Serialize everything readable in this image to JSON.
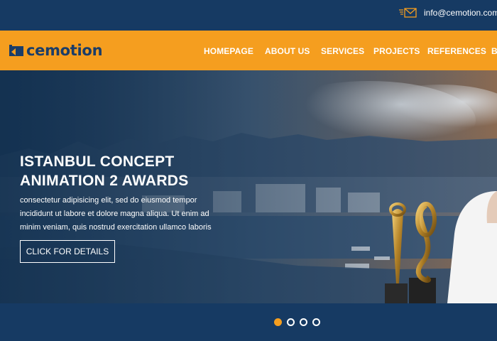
{
  "topbar": {
    "email": "info@cemotion.com",
    "icon": "envelope-icon"
  },
  "brand": {
    "name": "cemotion",
    "logo_icon": "square-logo-mark",
    "color": "#1b3d68"
  },
  "nav": {
    "items": [
      {
        "label": "HOMEPAGE"
      },
      {
        "label": "ABOUT US"
      },
      {
        "label": "SERVICES"
      },
      {
        "label": "PROJECTS"
      },
      {
        "label": "REFERENCES"
      },
      {
        "label": "B"
      }
    ]
  },
  "hero": {
    "title_line1": "ISTANBUL CONCEPT",
    "title_line2": "ANIMATION 2 AWARDS",
    "text": "consectetur adipisicing elit, sed do eiusmod tempor incididunt ut labore et dolore magna aliqua. Ut enim ad minim veniam, quis nostrud exercitation ullamco laboris",
    "button_label": "CLICK FOR DETAILS"
  },
  "slider": {
    "slide_count": 4,
    "active_index": 0
  },
  "colors": {
    "accent": "#f59e1f",
    "dark_blue": "#163a63",
    "white": "#ffffff"
  }
}
